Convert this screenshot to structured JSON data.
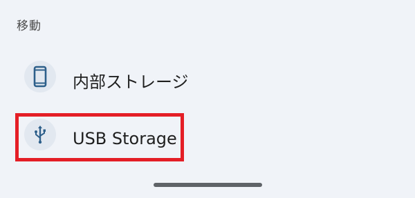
{
  "section": {
    "header": "移動"
  },
  "items": [
    {
      "label": "内部ストレージ",
      "icon": "phone-icon"
    },
    {
      "label": "USB Storage",
      "icon": "usb-icon"
    }
  ],
  "colors": {
    "background": "#f0f3f8",
    "icon_bg": "#e2e8f0",
    "icon_fg": "#2d5f8a",
    "highlight": "#e41e26",
    "home_indicator": "#5f6368"
  }
}
